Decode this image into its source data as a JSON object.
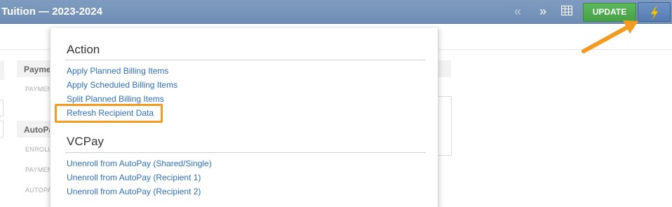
{
  "header": {
    "title": "Tuition — 2023-2024",
    "prev_icon": "«",
    "next_icon": "»",
    "update_label": "UPDATE"
  },
  "background": {
    "payment_heading": "Payme",
    "payment_label": "PAYMEN",
    "autopay_heading": "AutoPa",
    "enroll_label": "ENROLL",
    "payment_label_2": "PAYMEN",
    "autopay_label": "AUTOPA"
  },
  "menu": {
    "sections": [
      {
        "title": "Action",
        "items": [
          "Apply Planned Billing Items",
          "Apply Scheduled Billing Items",
          "Split Planned Billing Items",
          "Refresh Recipient Data"
        ]
      },
      {
        "title": "VCPay",
        "items": [
          "Unenroll from AutoPay (Shared/Single)",
          "Unenroll from AutoPay (Recipient 1)",
          "Unenroll from AutoPay (Recipient 2)"
        ]
      }
    ]
  },
  "colors": {
    "topbar": "#7390b6",
    "update_green": "#4cae4c",
    "bolt_yellow": "#f5c518",
    "link_blue": "#2f6fb5",
    "highlight_orange": "#f39a1f"
  },
  "icons": {
    "grid": "grid-icon",
    "bolt": "lightning-bolt-icon",
    "arrow": "annotation-arrow-icon"
  }
}
